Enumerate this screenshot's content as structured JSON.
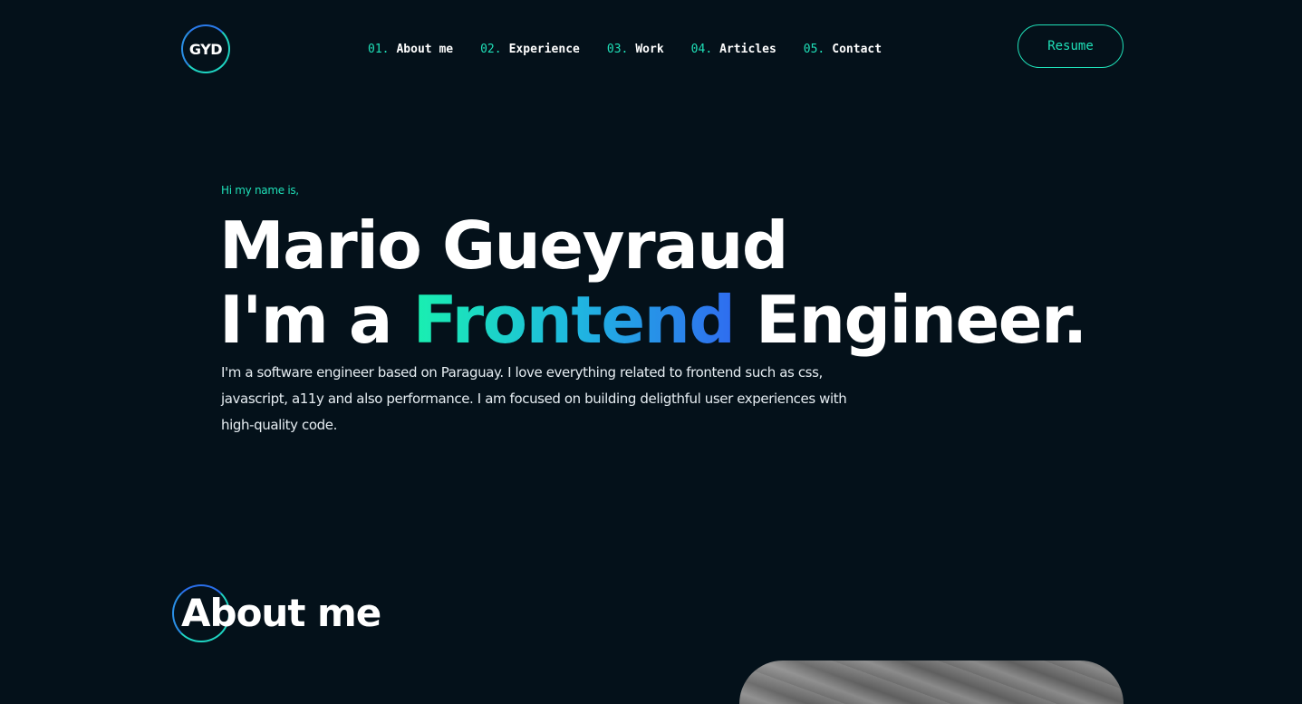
{
  "header": {
    "logo_text": "GYD",
    "nav": [
      {
        "num": "01.",
        "label": "About me"
      },
      {
        "num": "02.",
        "label": "Experience"
      },
      {
        "num": "03.",
        "label": "Work"
      },
      {
        "num": "04.",
        "label": "Articles"
      },
      {
        "num": "05.",
        "label": "Contact"
      }
    ],
    "resume_label": "Resume"
  },
  "hero": {
    "greeting": "Hi my name is,",
    "name": "Mario Gueyraud",
    "role_prefix": "I'm a",
    "role_highlight": "Frontend",
    "role_suffix": "Engineer.",
    "description": "I'm a software engineer based on Paraguay. I love everything related to frontend such as css, javascript, a11y and also performance. I am focused on building deligthful user experiences with high-quality code."
  },
  "about": {
    "heading": "About me"
  },
  "colors": {
    "background": "#04111a",
    "accent": "#1fe0b8",
    "accent_blue": "#2f6cf0",
    "text": "#ffffff"
  }
}
